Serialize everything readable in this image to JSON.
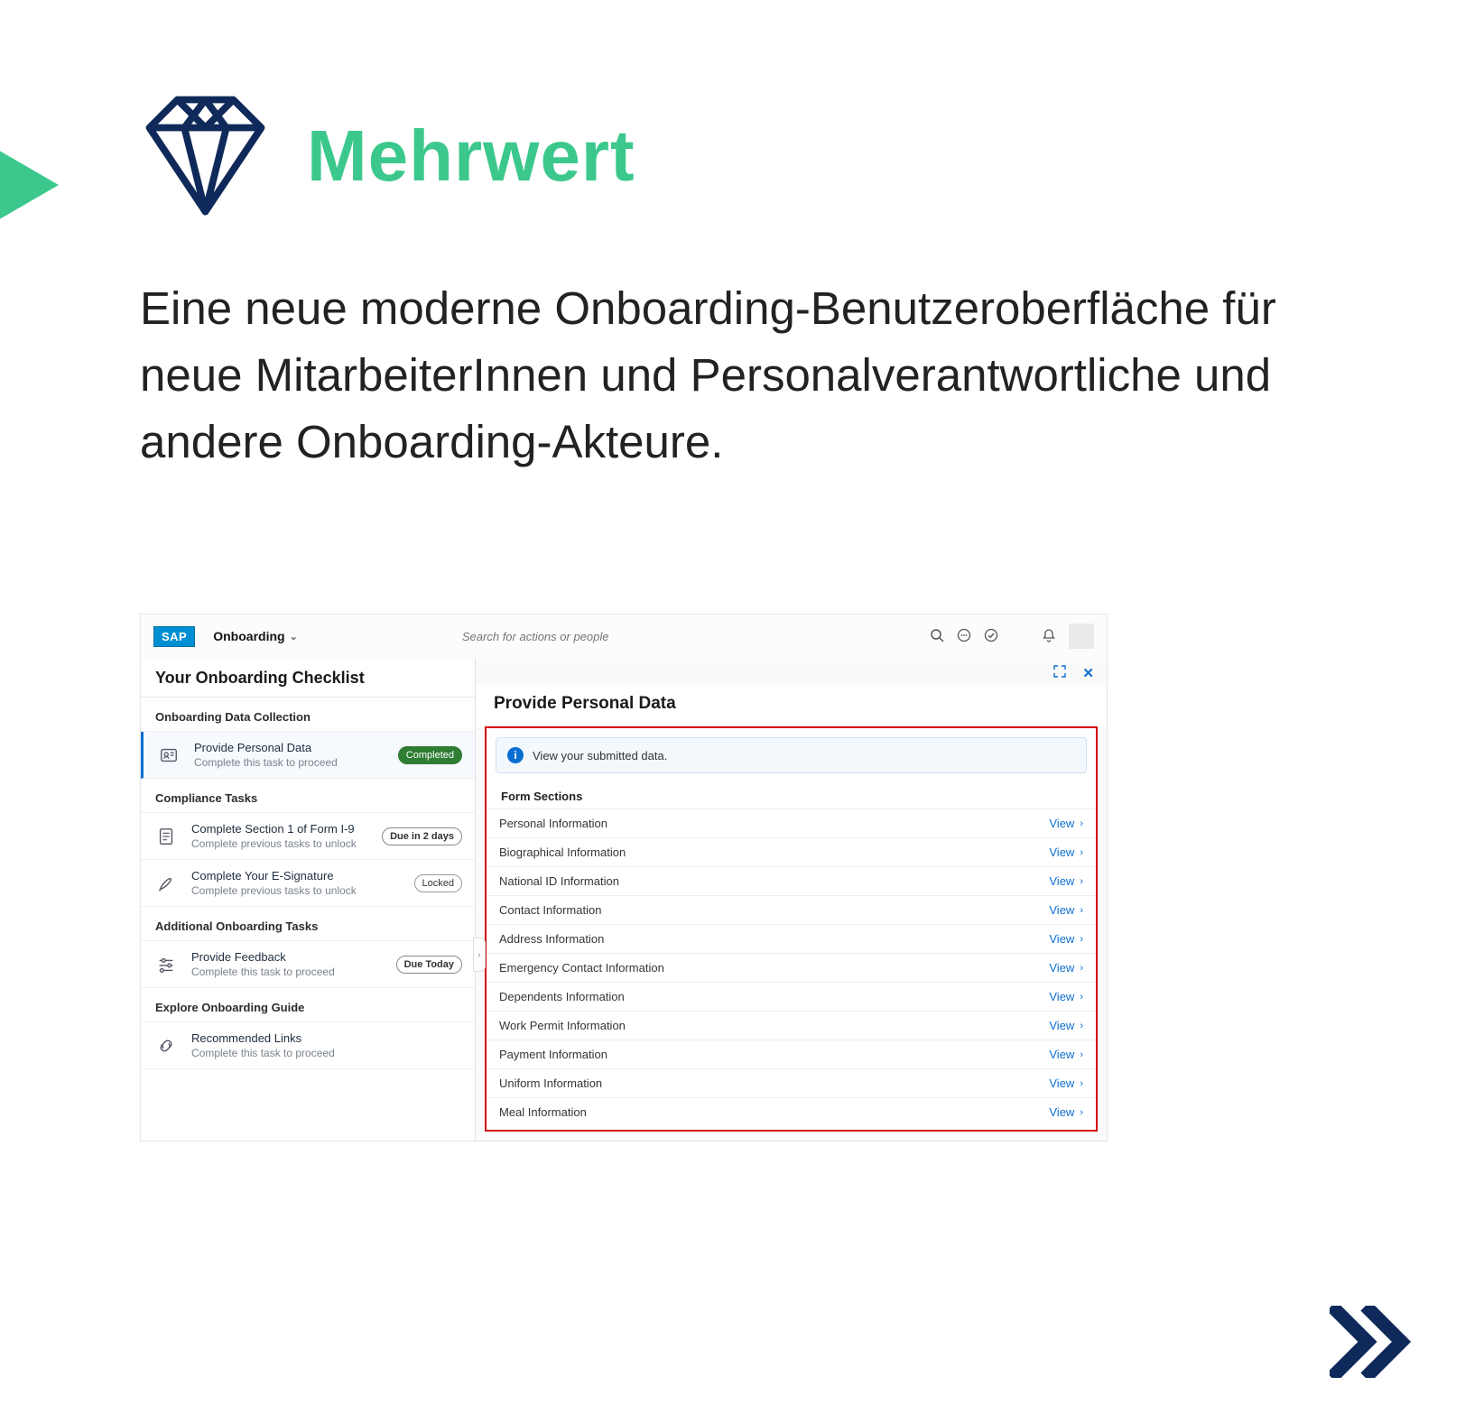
{
  "slide": {
    "title": "Mehrwert",
    "body": "Eine neue moderne Onboarding-Benutzer­oberfläche für neue MitarbeiterInnen und Personalverantwortliche und andere Onbo­arding-Akteure."
  },
  "shot": {
    "brand": "SAP",
    "app_menu": "Onboarding",
    "search_placeholder": "Search for actions or people",
    "left": {
      "header": "Your Onboarding Checklist",
      "sections": [
        {
          "label": "Onboarding Data Collection",
          "tasks": [
            {
              "title": "Provide Personal Data",
              "subtitle": "Complete this task to proceed",
              "badge": "Completed",
              "badge_kind": "completed",
              "active": true,
              "icon": "id-card"
            }
          ]
        },
        {
          "label": "Compliance Tasks",
          "tasks": [
            {
              "title": "Complete Section 1 of Form I-9",
              "subtitle": "Complete previous tasks to unlock",
              "badge": "Due in 2 days",
              "badge_kind": "due",
              "icon": "form"
            },
            {
              "title": "Complete Your E-Signature",
              "subtitle": "Complete previous tasks to unlock",
              "badge": "Locked",
              "badge_kind": "locked",
              "icon": "pen"
            }
          ]
        },
        {
          "label": "Additional Onboarding Tasks",
          "tasks": [
            {
              "title": "Provide Feedback",
              "subtitle": "Complete this task to proceed",
              "badge": "Due Today",
              "badge_kind": "due",
              "icon": "sliders"
            }
          ]
        },
        {
          "label": "Explore Onboarding Guide",
          "tasks": [
            {
              "title": "Recommended Links",
              "subtitle": "Complete this task to proceed",
              "badge": "",
              "badge_kind": "",
              "icon": "link"
            }
          ]
        }
      ]
    },
    "right": {
      "title": "Provide Personal Data",
      "info": "View your submitted data.",
      "form_sections_label": "Form Sections",
      "view_label": "View",
      "sections": [
        "Personal Information",
        "Biographical Information",
        "National ID Information",
        "Contact Information",
        "Address Information",
        "Emergency Contact Information",
        "Dependents Information",
        "Work Permit Information",
        "Payment Information",
        "Uniform Information",
        "Meal Information"
      ]
    }
  }
}
